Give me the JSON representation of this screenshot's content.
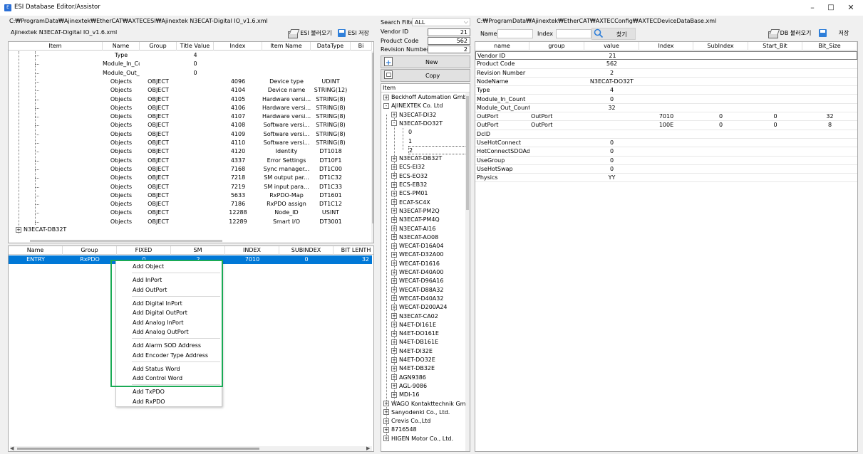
{
  "window": {
    "title": "ESI Database Editor/Assistor",
    "minimize": "–",
    "maximize": "□",
    "close": "✕"
  },
  "left": {
    "path": "C:₩ProgramData₩Ajinextek₩EtherCAT₩AXTECESI₩Ajinextek N3ECAT-Digital IO_v1.6.xml",
    "file_label": "Ajinextek N3ECAT-Digital IO_v1.6.xml",
    "esi_load": "ESI 불러오기",
    "esi_save": "ESI 저장",
    "tree_headers": [
      "Item",
      "Name",
      "Group",
      "Title Value",
      "Index",
      "Item Name",
      "DataType",
      "Bi"
    ],
    "tree_rows": [
      {
        "name": "Type",
        "group": "",
        "title": "4",
        "index": "",
        "itemname": "",
        "dtype": ""
      },
      {
        "name": "Module_In_Co...",
        "group": "",
        "title": "0",
        "index": "",
        "itemname": "",
        "dtype": ""
      },
      {
        "name": "Module_Out_C...",
        "group": "",
        "title": "0",
        "index": "",
        "itemname": "",
        "dtype": ""
      },
      {
        "name": "Objects",
        "group": "OBJECT",
        "title": "",
        "index": "4096",
        "itemname": "Device type",
        "dtype": "UDINT"
      },
      {
        "name": "Objects",
        "group": "OBJECT",
        "title": "",
        "index": "4104",
        "itemname": "Device name",
        "dtype": "STRING(12)"
      },
      {
        "name": "Objects",
        "group": "OBJECT",
        "title": "",
        "index": "4105",
        "itemname": "Hardware versi...",
        "dtype": "STRING(8)"
      },
      {
        "name": "Objects",
        "group": "OBJECT",
        "title": "",
        "index": "4106",
        "itemname": "Hardware versi...",
        "dtype": "STRING(8)"
      },
      {
        "name": "Objects",
        "group": "OBJECT",
        "title": "",
        "index": "4107",
        "itemname": "Hardware versi...",
        "dtype": "STRING(8)"
      },
      {
        "name": "Objects",
        "group": "OBJECT",
        "title": "",
        "index": "4108",
        "itemname": "Software versi...",
        "dtype": "STRING(8)"
      },
      {
        "name": "Objects",
        "group": "OBJECT",
        "title": "",
        "index": "4109",
        "itemname": "Software versi...",
        "dtype": "STRING(8)"
      },
      {
        "name": "Objects",
        "group": "OBJECT",
        "title": "",
        "index": "4110",
        "itemname": "Software versi...",
        "dtype": "STRING(8)"
      },
      {
        "name": "Objects",
        "group": "OBJECT",
        "title": "",
        "index": "4120",
        "itemname": "Identity",
        "dtype": "DT1018"
      },
      {
        "name": "Objects",
        "group": "OBJECT",
        "title": "",
        "index": "4337",
        "itemname": "Error Settings",
        "dtype": "DT10F1"
      },
      {
        "name": "Objects",
        "group": "OBJECT",
        "title": "",
        "index": "7168",
        "itemname": "Sync manager...",
        "dtype": "DT1C00"
      },
      {
        "name": "Objects",
        "group": "OBJECT",
        "title": "",
        "index": "7218",
        "itemname": "SM output par...",
        "dtype": "DT1C32"
      },
      {
        "name": "Objects",
        "group": "OBJECT",
        "title": "",
        "index": "7219",
        "itemname": "SM input para...",
        "dtype": "DT1C33"
      },
      {
        "name": "Objects",
        "group": "OBJECT",
        "title": "",
        "index": "5633",
        "itemname": "RxPDO-Map",
        "dtype": "DT1601"
      },
      {
        "name": "Objects",
        "group": "OBJECT",
        "title": "",
        "index": "7186",
        "itemname": "RxPDO assign",
        "dtype": "DT1C12"
      },
      {
        "name": "Objects",
        "group": "OBJECT",
        "title": "",
        "index": "12288",
        "itemname": "Node_ID",
        "dtype": "USINT"
      },
      {
        "name": "Objects",
        "group": "OBJECT",
        "title": "",
        "index": "12289",
        "itemname": "Smart I/O",
        "dtype": "DT3001"
      }
    ],
    "tree_last": "N3ECAT-DB32T",
    "entry_headers": [
      "Name",
      "Group",
      "FIXED",
      "SM",
      "INDEX",
      "SUBINDEX",
      "BIT LENTH"
    ],
    "entry_row": {
      "name": "ENTRY",
      "group": "RxPDO",
      "fixed": "0",
      "sm": "2",
      "index": "7010",
      "subindex": "0",
      "bitlen": "32"
    }
  },
  "context_menu": {
    "items": [
      "Add Object",
      "Add InPort",
      "Add OutPort",
      "Add Digital InPort",
      "Add Digital OutPort",
      "Add Analog InPort",
      "Add Analog OutPort",
      "Add Alarm SOD Address",
      "Add Encoder Type Address",
      "Add Status Word",
      "Add Control Word",
      "Add TxPDO",
      "Add RxPDO"
    ]
  },
  "middle": {
    "search_filter_label": "Search Filter",
    "search_filter_value": "ALL",
    "vendor_id_label": "Vendor ID",
    "vendor_id_value": "21",
    "product_code_label": "Product Code",
    "product_code_value": "562",
    "revision_label": "Revision Number",
    "revision_value": "2",
    "new_label": "New",
    "copy_label": "Copy",
    "item_header": "Item",
    "vendors_top": [
      "Beckhoff Automation GmbH",
      "AJINEXTEK Co. Ltd"
    ],
    "products_before": [
      "N3ECAT-DI32",
      "N3ECAT-DO32T"
    ],
    "revisions": [
      "0",
      "1",
      "2"
    ],
    "products_after": [
      "N3ECAT-DB32T",
      "ECS-EI32",
      "ECS-EO32",
      "ECS-EB32",
      "ECS-PM01",
      "ECAT-SC4X",
      "N3ECAT-PM2Q",
      "N3ECAT-PM4Q",
      "N3ECAT-AI16",
      "N3ECAT-AO08",
      "WECAT-D16A04",
      "WECAT-D32A00",
      "WECAT-D1616",
      "WECAT-D40A00",
      "WECAT-D96A16",
      "WECAT-D88A32",
      "WECAT-D40A32",
      "WECAT-D200A24",
      "N3ECAT-CA02",
      "N4ET-DI161E",
      "N4ET-DO161E",
      "N4ET-DB161E",
      "N4ET-DI32E",
      "N4ET-DO32E",
      "N4ET-DB32E",
      "AGN9386",
      "AGL-9086",
      "MDI-16"
    ],
    "vendors_bottom": [
      "WAGO Kontakttechnik GmbH",
      "Sanyodenki Co., Ltd.",
      "Crevis Co.,Ltd",
      "8716548",
      "HIGEN Motor Co., Ltd."
    ]
  },
  "right": {
    "path": "C:₩ProgramData₩Ajinextek₩EtherCAT₩AXTECConfig₩AXTECDeviceDataBase.xml",
    "name_label": "Name",
    "index_label": "Index",
    "find_label": "찾기",
    "db_load": "DB 불러오기",
    "db_save": "저장",
    "headers": [
      "name",
      "group",
      "value",
      "Index",
      "SubIndex",
      "Start_Bit",
      "Bit_Size"
    ],
    "rows": [
      {
        "name": "Vendor ID",
        "group": "",
        "value": "21",
        "index": "",
        "sub": "",
        "start": "",
        "size": ""
      },
      {
        "name": "Product Code",
        "group": "",
        "value": "562",
        "index": "",
        "sub": "",
        "start": "",
        "size": ""
      },
      {
        "name": "Revision Number",
        "group": "",
        "value": "2",
        "index": "",
        "sub": "",
        "start": "",
        "size": ""
      },
      {
        "name": "NodeName",
        "group": "",
        "value": "N3ECAT-DO32T",
        "index": "",
        "sub": "",
        "start": "",
        "size": ""
      },
      {
        "name": "Type",
        "group": "",
        "value": "4",
        "index": "",
        "sub": "",
        "start": "",
        "size": ""
      },
      {
        "name": "Module_In_Count",
        "group": "",
        "value": "0",
        "index": "",
        "sub": "",
        "start": "",
        "size": ""
      },
      {
        "name": "Module_Out_Count",
        "group": "",
        "value": "32",
        "index": "",
        "sub": "",
        "start": "",
        "size": ""
      },
      {
        "name": "OutPort",
        "group": "OutPort",
        "value": "",
        "index": "7010",
        "sub": "0",
        "start": "0",
        "size": "32"
      },
      {
        "name": "OutPort",
        "group": "OutPort",
        "value": "",
        "index": "100E",
        "sub": "0",
        "start": "0",
        "size": "8"
      },
      {
        "name": "DcID",
        "group": "",
        "value": "",
        "index": "",
        "sub": "",
        "start": "",
        "size": ""
      },
      {
        "name": "UseHotConnect",
        "group": "",
        "value": "0",
        "index": "",
        "sub": "",
        "start": "",
        "size": ""
      },
      {
        "name": "HotConnectSDOAd...",
        "group": "",
        "value": "0",
        "index": "",
        "sub": "",
        "start": "",
        "size": ""
      },
      {
        "name": "UseGroup",
        "group": "",
        "value": "0",
        "index": "",
        "sub": "",
        "start": "",
        "size": ""
      },
      {
        "name": "UseHotSwap",
        "group": "",
        "value": "0",
        "index": "",
        "sub": "",
        "start": "",
        "size": ""
      },
      {
        "name": "Physics",
        "group": "",
        "value": "YY",
        "index": "",
        "sub": "",
        "start": "",
        "size": ""
      }
    ]
  },
  "colors": {
    "selection": "#0078d7",
    "highlight_frame": "#1aaa55"
  }
}
